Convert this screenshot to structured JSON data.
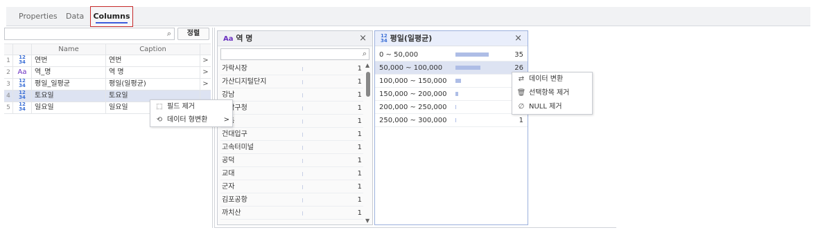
{
  "tabs": [
    {
      "label": "Properties"
    },
    {
      "label": "Data"
    },
    {
      "label": "Columns"
    }
  ],
  "left": {
    "sort_label": "정렬",
    "headers": {
      "name": "Name",
      "caption": "Caption"
    },
    "rows": [
      {
        "num": "1",
        "type_top": "12",
        "type_bottom": "34",
        "name": "연번",
        "caption": "연번",
        "arrow": ">"
      },
      {
        "num": "2",
        "type": "Aa",
        "name": "역_명",
        "caption": "역 명",
        "arrow": ">"
      },
      {
        "num": "3",
        "type_top": "12",
        "type_bottom": "34",
        "name": "평일_일평균",
        "caption": "평일(일평균)",
        "arrow": ">"
      },
      {
        "num": "4",
        "type_top": "12",
        "type_bottom": "34",
        "name": "토요일",
        "caption": "토요일",
        "arrow": ""
      },
      {
        "num": "5",
        "type_top": "12",
        "type_bottom": "34",
        "name": "일요일",
        "caption": "일요일",
        "arrow": ""
      }
    ]
  },
  "context_menu_left": {
    "items": [
      {
        "label": "필드 제거"
      },
      {
        "label": "데이터 형변환",
        "submenu": ">"
      }
    ]
  },
  "panel_station": {
    "type_label": "Aa",
    "title": "역   명",
    "close": "×",
    "rows": [
      {
        "label": "가락시장",
        "count": "1"
      },
      {
        "label": "가산디지털단지",
        "count": "1"
      },
      {
        "label": "강남",
        "count": "1"
      },
      {
        "label": "강남구청",
        "count": "1"
      },
      {
        "label": "강동",
        "count": "1"
      },
      {
        "label": "건대입구",
        "count": "1"
      },
      {
        "label": "고속터미널",
        "count": "1"
      },
      {
        "label": "공덕",
        "count": "1"
      },
      {
        "label": "교대",
        "count": "1"
      },
      {
        "label": "군자",
        "count": "1"
      },
      {
        "label": "김포공항",
        "count": "1"
      },
      {
        "label": "까치산",
        "count": "1"
      }
    ]
  },
  "panel_weekday": {
    "type_top": "12",
    "type_bottom": "34",
    "title": "평일(일평균)",
    "close": "×",
    "bins": [
      {
        "label": "0 ~ 50,000",
        "count": "35",
        "value": 35
      },
      {
        "label": "50,000 ~ 100,000",
        "count": "26",
        "value": 26
      },
      {
        "label": "100,000 ~ 150,000",
        "count": "",
        "value": 6
      },
      {
        "label": "150,000 ~ 200,000",
        "count": "",
        "value": 3
      },
      {
        "label": "200,000 ~ 250,000",
        "count": "",
        "value": 1
      },
      {
        "label": "250,000 ~ 300,000",
        "count": "1",
        "value": 1
      }
    ]
  },
  "context_menu_right": {
    "items": [
      {
        "label": "데이터 변환"
      },
      {
        "label": "선택항목 제거"
      },
      {
        "label": "NULL 제거"
      }
    ]
  },
  "colors": {
    "accent": "#3b5bdb",
    "highlight": "#dde3f2",
    "bar": "#aebde6",
    "tab_outline": "#c62828"
  }
}
